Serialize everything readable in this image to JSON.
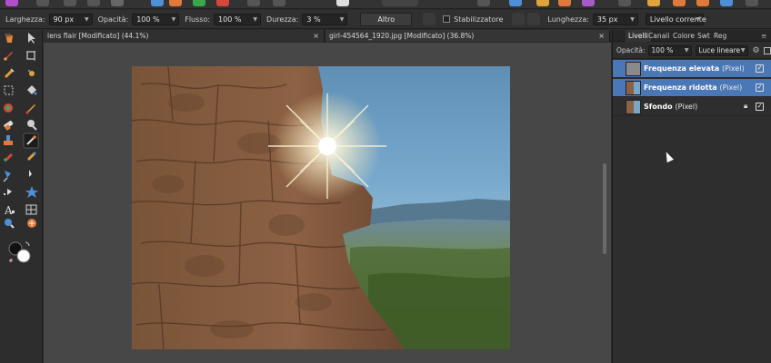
{
  "context_toolbar": {
    "width_label": "Larghezza:",
    "width_value": "90 px",
    "opacity_label": "Opacità:",
    "opacity_value": "100 %",
    "flow_label": "Flusso:",
    "flow_value": "100 %",
    "hardness_label": "Durezza:",
    "hardness_value": "3 %",
    "more_button": "Altro",
    "stabilizer_label": "Stabilizzatore",
    "length_label": "Lunghezza:",
    "length_value": "35 px",
    "layer_scope": "Livello corrente"
  },
  "document_tabs": [
    {
      "label": "lens flair [Modificato] (44.1%)",
      "close": "×"
    },
    {
      "label": "girl-454564_1920.jpg [Modificato] (36.8%)",
      "close": "×"
    }
  ],
  "panel": {
    "tabs": [
      "Livelli",
      "Canali",
      "Colore",
      "Swt",
      "Reg"
    ],
    "opacity_label": "Opacità:",
    "opacity_value": "100 %",
    "blend_mode": "Luce lineare",
    "layers": [
      {
        "name": "Frequenza elevata",
        "type": "(Pixel)",
        "selected": true,
        "locked": false
      },
      {
        "name": "Frequenza ridotta",
        "type": "(Pixel)",
        "selected": true,
        "locked": false
      },
      {
        "name": "Sfondo",
        "type": "(Pixel)",
        "selected": false,
        "locked": true
      }
    ]
  },
  "colors": {
    "selection": "#4a78b7",
    "canvas_bg": "#474747",
    "ui_bg": "#2e2e2e"
  },
  "icons": {
    "tools": [
      "hand-icon",
      "move-icon",
      "brush-icon",
      "crop-icon",
      "color-picker-icon",
      "paint-mixer-icon",
      "marquee-icon",
      "fill-icon",
      "erase-brush-icon",
      "healing-icon",
      "dodge-icon",
      "clone-icon",
      "blemish-icon",
      "frequency-brush-icon",
      "red-eye-icon",
      "smudge-icon",
      "pen-icon",
      "node-icon",
      "shape-icon",
      "star-icon",
      "text-icon",
      "mesh-icon",
      "zoom-icon",
      "color-swatch-icon"
    ]
  }
}
